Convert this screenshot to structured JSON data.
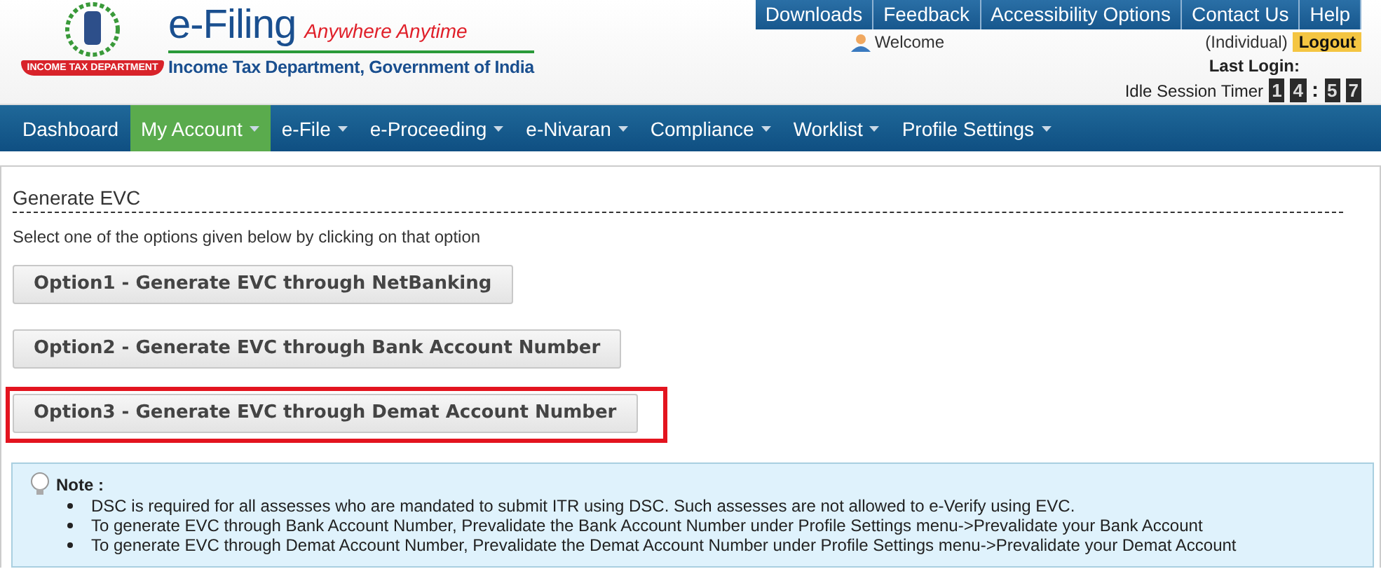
{
  "header": {
    "logo_ribbon": "INCOME TAX DEPARTMENT",
    "brand": "e-Filing",
    "tagline": "Anywhere Anytime",
    "department": "Income Tax Department, Government of India"
  },
  "top_links": [
    "Downloads",
    "Feedback",
    "Accessibility Options",
    "Contact Us",
    "Help"
  ],
  "user": {
    "welcome": "Welcome",
    "role": "(Individual)",
    "logout": "Logout",
    "last_login": "Last Login:",
    "timer_label": "Idle Session Timer",
    "timer_digits": [
      "1",
      "4",
      ":",
      "5",
      "7"
    ]
  },
  "nav": [
    {
      "label": "Dashboard",
      "selected": false,
      "dropdown": false
    },
    {
      "label": "My Account",
      "selected": true,
      "dropdown": true
    },
    {
      "label": "e-File",
      "selected": false,
      "dropdown": true
    },
    {
      "label": "e-Proceeding",
      "selected": false,
      "dropdown": true
    },
    {
      "label": "e-Nivaran",
      "selected": false,
      "dropdown": true
    },
    {
      "label": "Compliance",
      "selected": false,
      "dropdown": true
    },
    {
      "label": "Worklist",
      "selected": false,
      "dropdown": true
    },
    {
      "label": "Profile Settings",
      "selected": false,
      "dropdown": true
    }
  ],
  "page": {
    "title": "Generate EVC",
    "instruction": "Select one of the options given below by clicking on that option",
    "options": [
      {
        "label": "Option1 - Generate EVC through NetBanking",
        "highlighted": false
      },
      {
        "label": "Option2 - Generate EVC through Bank Account Number",
        "highlighted": false
      },
      {
        "label": "Option3 - Generate EVC through Demat Account Number",
        "highlighted": true
      }
    ]
  },
  "note": {
    "title": "Note :",
    "items": [
      "DSC is required for all assesses who are mandated to submit ITR using DSC. Such assesses are not allowed to e-Verify using EVC.",
      "To generate EVC through Bank Account Number, Prevalidate the Bank Account Number under Profile Settings menu->Prevalidate your Bank Account",
      "To generate EVC through Demat Account Number, Prevalidate the Demat Account Number under Profile Settings menu->Prevalidate your Demat Account"
    ]
  }
}
